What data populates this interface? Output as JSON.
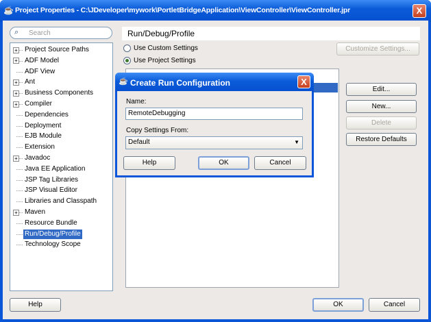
{
  "window": {
    "title": "Project Properties - C:\\JDeveloper\\mywork\\PortletBridgeApplication\\ViewController\\ViewController.jpr",
    "close": "X"
  },
  "search": {
    "placeholder": "Search"
  },
  "tree": {
    "items": [
      {
        "label": "Project Source Paths",
        "expandable": true
      },
      {
        "label": "ADF Model",
        "expandable": true
      },
      {
        "label": "ADF View",
        "expandable": false
      },
      {
        "label": "Ant",
        "expandable": true
      },
      {
        "label": "Business Components",
        "expandable": true
      },
      {
        "label": "Compiler",
        "expandable": true
      },
      {
        "label": "Dependencies",
        "expandable": false
      },
      {
        "label": "Deployment",
        "expandable": false
      },
      {
        "label": "EJB Module",
        "expandable": false
      },
      {
        "label": "Extension",
        "expandable": false
      },
      {
        "label": "Javadoc",
        "expandable": true
      },
      {
        "label": "Java EE Application",
        "expandable": false
      },
      {
        "label": "JSP Tag Libraries",
        "expandable": false
      },
      {
        "label": "JSP Visual Editor",
        "expandable": false
      },
      {
        "label": "Libraries and Classpath",
        "expandable": false
      },
      {
        "label": "Maven",
        "expandable": true
      },
      {
        "label": "Resource Bundle",
        "expandable": false
      },
      {
        "label": "Run/Debug/Profile",
        "expandable": false,
        "selected": true
      },
      {
        "label": "Technology Scope",
        "expandable": false
      }
    ]
  },
  "panel": {
    "title": "Run/Debug/Profile",
    "radio_custom": "Use Custom Settings",
    "radio_project": "Use Project Settings",
    "customize": "Customize Settings...",
    "edit": "Edit...",
    "new": "New...",
    "delete": "Delete",
    "restore": "Restore Defaults"
  },
  "footer": {
    "help": "Help",
    "ok": "OK",
    "cancel": "Cancel"
  },
  "dialog": {
    "title": "Create Run Configuration",
    "name_label": "Name:",
    "name_value": "RemoteDebugging",
    "copy_label": "Copy Settings From:",
    "copy_value": "Default",
    "help": "Help",
    "ok": "OK",
    "cancel": "Cancel",
    "close": "X"
  }
}
